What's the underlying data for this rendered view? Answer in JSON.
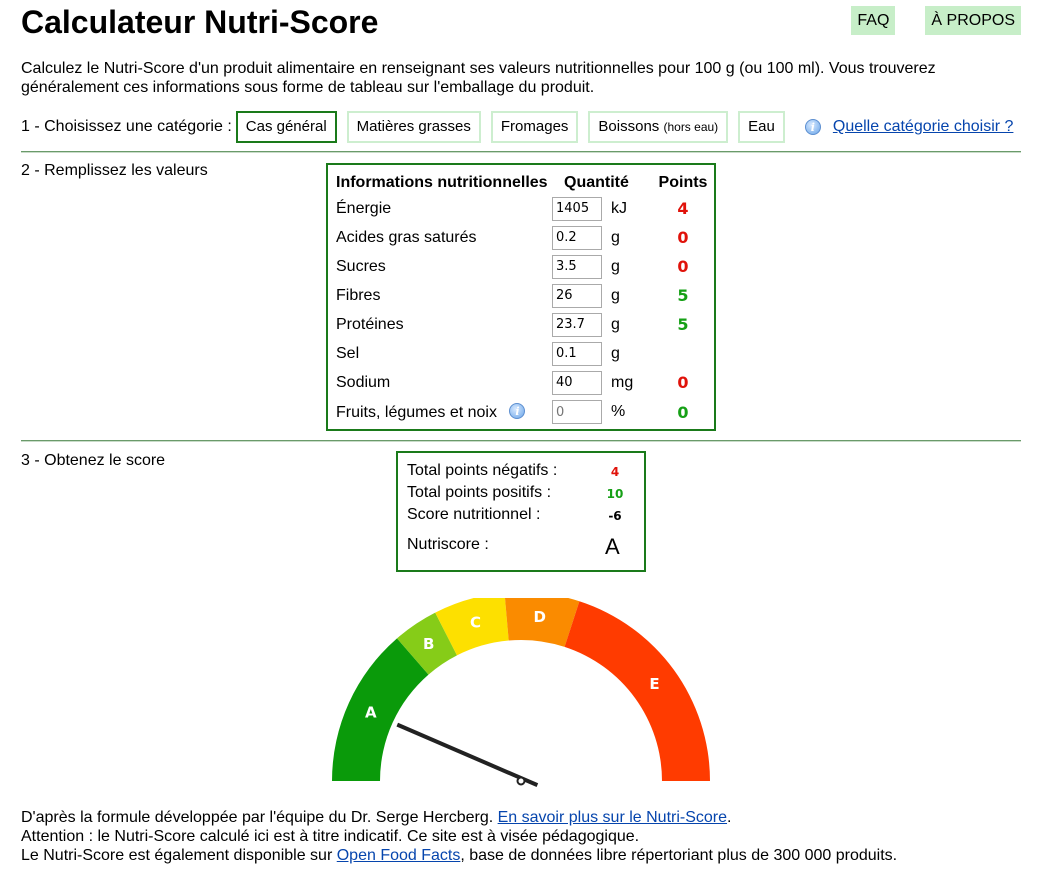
{
  "title": "Calculateur Nutri-Score",
  "nav": {
    "faq": "FAQ",
    "about": "À PROPOS"
  },
  "intro": "Calculez le Nutri-Score d'un produit alimentaire en renseignant ses valeurs nutritionnelles pour 100 g (ou 100 ml). Vous trouverez généralement ces informations sous forme de tableau sur l'emballage du produit.",
  "step1": {
    "label": "1 - Choisissez une catégorie :",
    "categories": [
      "Cas général",
      "Matières grasses",
      "Fromages",
      "Boissons",
      "Eau"
    ],
    "boissons_note": "(hors eau)",
    "help_icon": "info-icon",
    "help_link": "Quelle catégorie choisir ?"
  },
  "step2": {
    "label": "2 - Remplissez les valeurs",
    "headers": [
      "Informations nutritionnelles",
      "Quantité",
      "Points"
    ],
    "rows": [
      {
        "name": "Énergie",
        "value": "1405",
        "unit": "kJ",
        "points": "4",
        "type": "neg"
      },
      {
        "name": "Acides gras saturés",
        "value": "0.2",
        "unit": "g",
        "points": "0",
        "type": "neg"
      },
      {
        "name": "Sucres",
        "value": "3.5",
        "unit": "g",
        "points": "0",
        "type": "neg"
      },
      {
        "name": "Fibres",
        "value": "26",
        "unit": "g",
        "points": "5",
        "type": "pos"
      },
      {
        "name": "Protéines",
        "value": "23.7",
        "unit": "g",
        "points": "5",
        "type": "pos"
      },
      {
        "name": "Sel",
        "value": "0.1",
        "unit": "g",
        "points": "",
        "type": "neg"
      },
      {
        "name": "Sodium",
        "value": "40",
        "unit": "mg",
        "points": "0",
        "type": "neg"
      },
      {
        "name": "Fruits, légumes et noix",
        "value": "",
        "placeholder": "0",
        "unit": "%",
        "points": "0",
        "type": "pos"
      }
    ]
  },
  "step3": {
    "label": "3 - Obtenez le score",
    "neg_label": "Total points négatifs :",
    "neg_value": "4",
    "pos_label": "Total points positifs :",
    "pos_value": "10",
    "score_label": "Score nutritionnel :",
    "score_value": "-6",
    "nutri_label": "Nutriscore :",
    "nutri_value": "A"
  },
  "gauge": {
    "grades": [
      "A",
      "B",
      "C",
      "D",
      "E"
    ],
    "colors": {
      "A": "#0a9a0a",
      "B": "#86cc18",
      "C": "#fde000",
      "D": "#fa8b00",
      "E": "#ff3b00"
    },
    "needle_grade": "A"
  },
  "footer": {
    "line1_text": "D'après la formule développée par l'équipe du Dr. Serge Hercberg.",
    "line1_link": "En savoir plus sur le Nutri-Score",
    "line2": "Attention : le Nutri-Score calculé ici est à titre indicatif. Ce site est à visée pédagogique.",
    "line3_pre": "Le Nutri-Score est également disponible sur",
    "line3_link": "Open Food Facts",
    "line3_post": ", base de données libre répertoriant plus de 300 000 produits."
  }
}
